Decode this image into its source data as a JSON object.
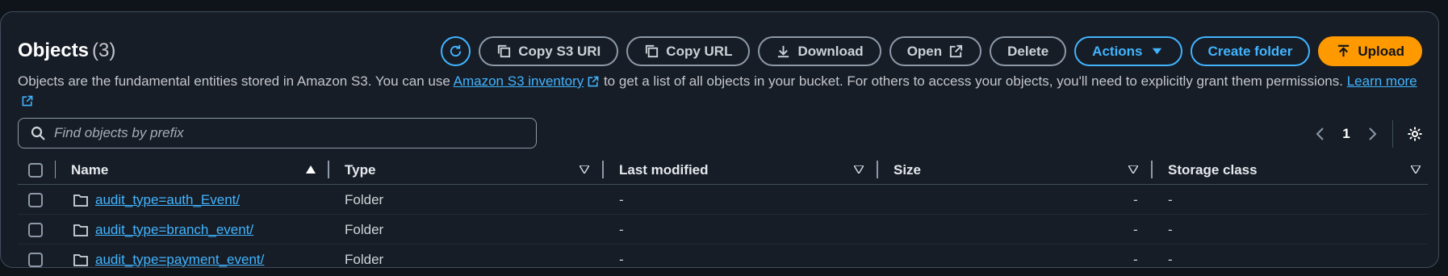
{
  "header": {
    "title": "Objects",
    "count": "(3)"
  },
  "toolbar": {
    "copy_s3_uri": "Copy S3 URI",
    "copy_url": "Copy URL",
    "download": "Download",
    "open": "Open",
    "delete": "Delete",
    "actions": "Actions",
    "create_folder": "Create folder",
    "upload": "Upload"
  },
  "description": {
    "part1": "Objects are the fundamental entities stored in Amazon S3. You can use ",
    "inventory_link": "Amazon S3 inventory",
    "part2": " to get a list of all objects in your bucket. For others to access your objects, you'll need to explicitly grant them permissions. ",
    "learn_more": "Learn more"
  },
  "search": {
    "placeholder": "Find objects by prefix"
  },
  "pagination": {
    "current_page": "1"
  },
  "table": {
    "columns": {
      "name": "Name",
      "type": "Type",
      "last_modified": "Last modified",
      "size": "Size",
      "storage_class": "Storage class"
    },
    "rows": [
      {
        "name": "audit_type=auth_Event/",
        "type": "Folder",
        "last_modified": "-",
        "size": "-",
        "storage_class": "-"
      },
      {
        "name": "audit_type=branch_event/",
        "type": "Folder",
        "last_modified": "-",
        "size": "-",
        "storage_class": "-"
      },
      {
        "name": "audit_type=payment_event/",
        "type": "Folder",
        "last_modified": "-",
        "size": "-",
        "storage_class": "-"
      }
    ]
  },
  "colors": {
    "accent": "#42b4ff",
    "primary": "#ff9900",
    "background": "#161d26"
  }
}
